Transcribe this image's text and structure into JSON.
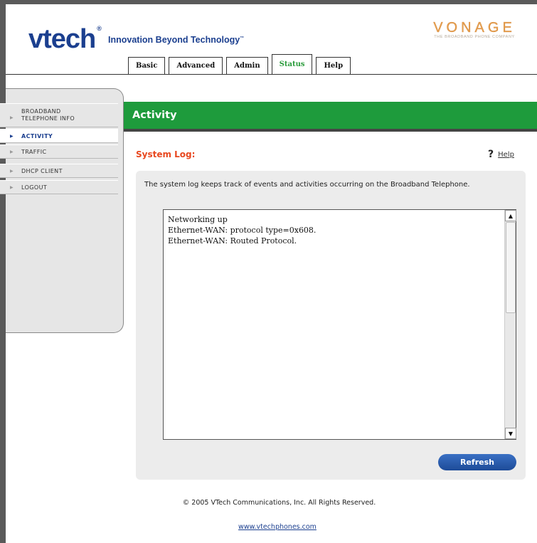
{
  "header": {
    "logo": "vtech",
    "logo_mark": "®",
    "tagline": "Innovation Beyond Technology",
    "tagline_mark": "™",
    "partner_name": "VONAGE",
    "partner_subtitle": "THE BROADBAND PHONE COMPANY"
  },
  "tabs": [
    {
      "label": "Basic"
    },
    {
      "label": "Advanced"
    },
    {
      "label": "Admin"
    },
    {
      "label": "Status"
    },
    {
      "label": "Help"
    }
  ],
  "sidebar": {
    "items": [
      {
        "label_line1": "BROADBAND",
        "label_line2": "TELEPHONE INFO"
      },
      {
        "label": "ACTIVITY"
      },
      {
        "label": "TRAFFIC"
      },
      {
        "label": "DHCP CLIENT"
      },
      {
        "label": "LOGOUT"
      }
    ],
    "arrow": "▶"
  },
  "main": {
    "page_title": "Activity",
    "section_title": "System Log:",
    "help_icon": "?",
    "help_label": "Help",
    "description": "The system log keeps track of events and activities occurring on the Broadband Telephone.",
    "log_lines": "Networking up\nEthernet-WAN: protocol type=0x608.\nEthernet-WAN: Routed Protocol.",
    "refresh_label": "Refresh"
  },
  "footer": {
    "copyright": "© 2005 VTech Communications, Inc. All Rights Reserved.",
    "website": "www.vtechphones.com"
  },
  "colors": {
    "brand_blue": "#1b3f8f",
    "activity_green": "#1e9b3c",
    "section_orange": "#e8471e",
    "vonage_orange": "#e8a050"
  }
}
